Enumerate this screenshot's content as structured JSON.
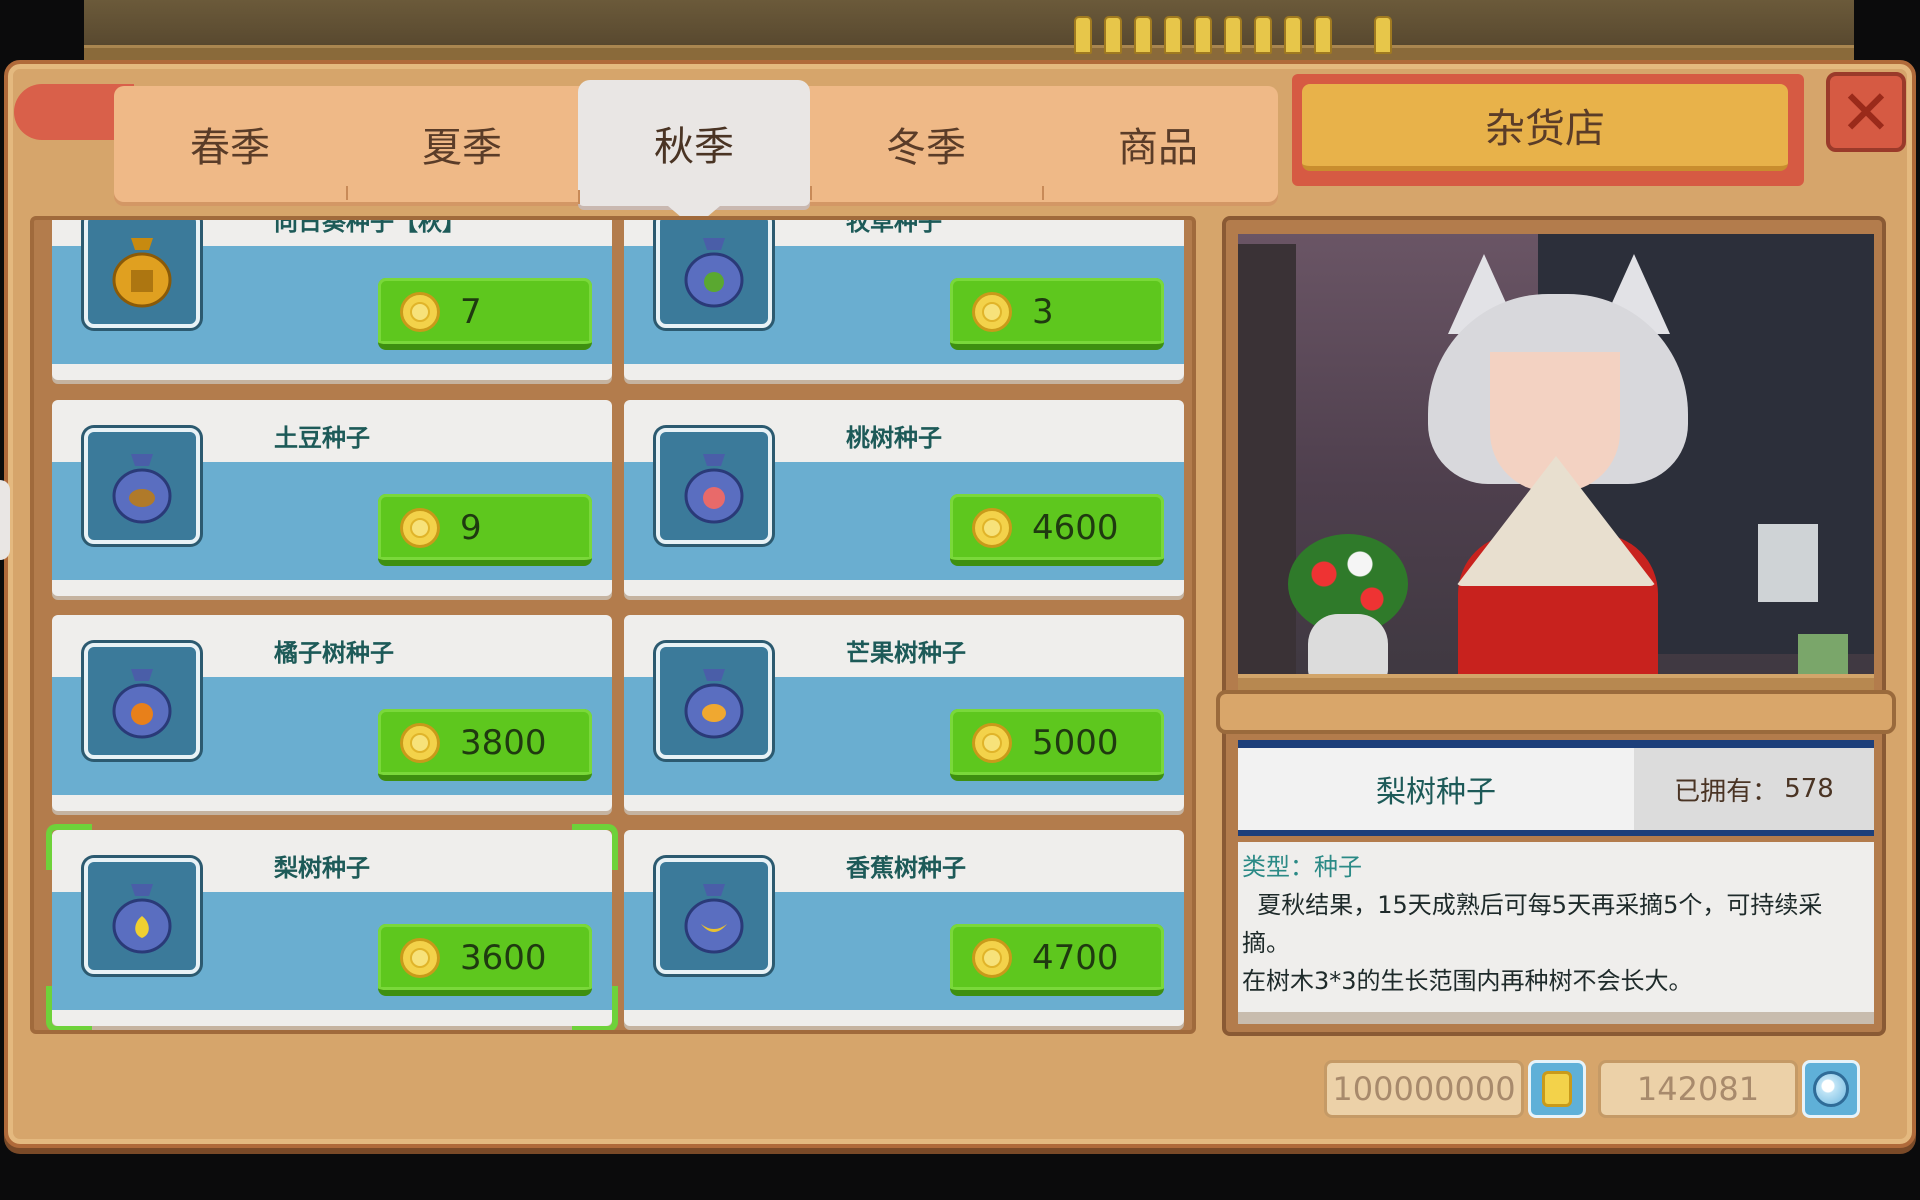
{
  "tabs": [
    {
      "label": "春季"
    },
    {
      "label": "夏季"
    },
    {
      "label": "秋季"
    },
    {
      "label": "冬季"
    },
    {
      "label": "商品"
    }
  ],
  "active_tab": "秋季",
  "shop_name": "杂货店",
  "close_label": "✕",
  "items": [
    {
      "name": "向日葵种子【秋】",
      "price": "7",
      "icon": "golden-seed-bag-icon",
      "color": "#e0a020"
    },
    {
      "name": "牧草种子",
      "price": "3",
      "icon": "grass-seed-bag-icon",
      "color": "#5aa830"
    },
    {
      "name": "土豆种子",
      "price": "9",
      "icon": "potato-seed-bag-icon",
      "color": "#b07a2a"
    },
    {
      "name": "桃树种子",
      "price": "4600",
      "icon": "peach-seed-bag-icon",
      "color": "#e86a6a"
    },
    {
      "name": "橘子树种子",
      "price": "3800",
      "icon": "orange-seed-bag-icon",
      "color": "#e8801a"
    },
    {
      "name": "芒果树种子",
      "price": "5000",
      "icon": "mango-seed-bag-icon",
      "color": "#f0a830"
    },
    {
      "name": "梨树种子",
      "price": "3600",
      "icon": "pear-seed-bag-icon",
      "color": "#f0d030",
      "selected": true
    },
    {
      "name": "香蕉树种子",
      "price": "4700",
      "icon": "banana-seed-bag-icon",
      "color": "#e8c030"
    }
  ],
  "detail": {
    "name": "梨树种子",
    "owned_label": "已拥有：",
    "owned_value": "578",
    "type_line": "类型：种子",
    "desc_line1": "  夏秋结果，15天成熟后可每5天再采摘5个，可持续采摘。",
    "desc_line2": "在树木3*3的生长范围内再种树不会长大。"
  },
  "currency": {
    "gold": "100000000",
    "gems": "142081"
  },
  "colors": {
    "price_button": "#5ec71e",
    "panel": "#d6a56b",
    "accent_red": "#d65a43",
    "item_name": "#1d5a58"
  }
}
